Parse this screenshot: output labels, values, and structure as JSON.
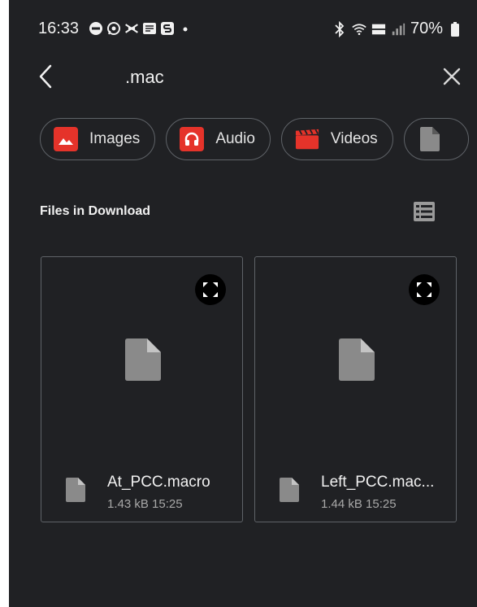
{
  "status_bar": {
    "time": "16:33",
    "left_icons": [
      "dnd-icon",
      "whatsapp-icon",
      "halifax-icon",
      "message-icon",
      "s-app-icon",
      "dot-icon"
    ],
    "right_icons": [
      "bluetooth-icon",
      "wifi-icon",
      "volte-icon",
      "signal-icon"
    ],
    "battery_text": "70%"
  },
  "toolbar": {
    "search_query": ".mac",
    "back_icon": "chevron-left-icon",
    "close_icon": "close-icon"
  },
  "filter_chips": [
    {
      "label": "Images",
      "icon": "image-icon"
    },
    {
      "label": "Audio",
      "icon": "headphones-icon"
    },
    {
      "label": "Videos",
      "icon": "clapperboard-icon"
    },
    {
      "label": "",
      "icon": "document-icon"
    }
  ],
  "section": {
    "title": "Files in Download",
    "view_toggle_icon": "list-view-icon"
  },
  "files": [
    {
      "name": "At_PCC.macro",
      "size": "1.43 kB",
      "time": "15:25",
      "meta": "1.43 kB 15:25"
    },
    {
      "name": "Left_PCC.mac...",
      "size": "1.44 kB",
      "time": "15:25",
      "meta": "1.44 kB 15:25"
    }
  ],
  "colors": {
    "background": "#202124",
    "chip_border": "#5f6368",
    "accent_red": "#e5332a",
    "file_icon_gray": "#8a8a8a"
  }
}
